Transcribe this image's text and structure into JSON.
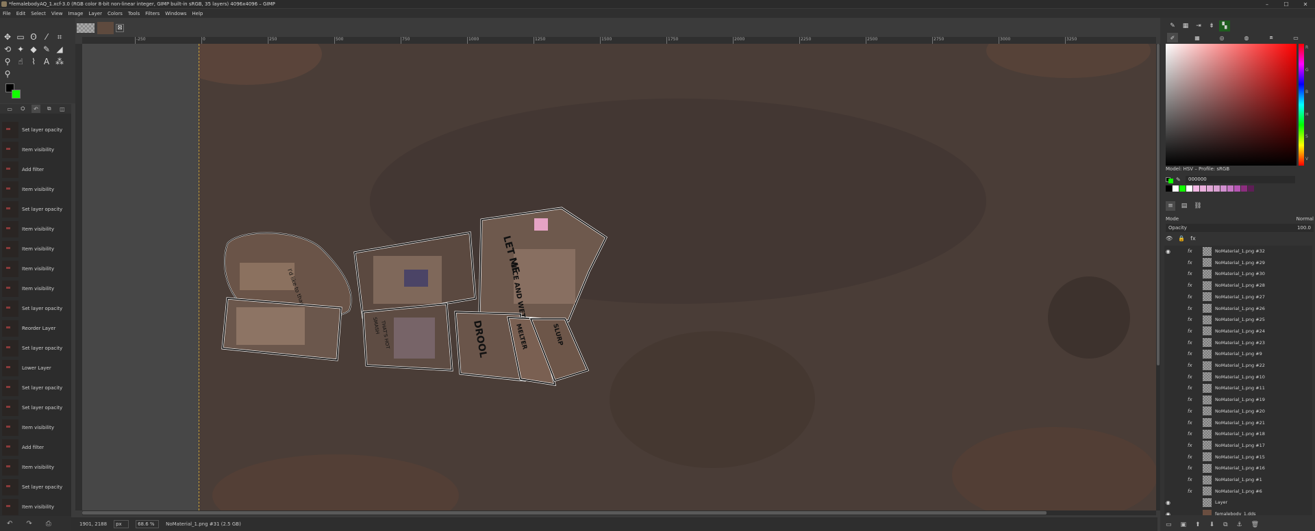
{
  "window": {
    "title": "*femalebodyAQ_1.xcf-3.0 (RGB color 8-bit non-linear integer, GIMP built-in sRGB, 35 layers) 4096x4096 – GIMP",
    "minimize": "–",
    "maximize": "☐",
    "close": "✕"
  },
  "menu": [
    "File",
    "Edit",
    "Select",
    "View",
    "Image",
    "Layer",
    "Colors",
    "Tools",
    "Filters",
    "Windows",
    "Help"
  ],
  "toolbox": {
    "tools": [
      {
        "name": "move-tool-icon",
        "glyph": "✥"
      },
      {
        "name": "rect-select-icon",
        "glyph": "▭"
      },
      {
        "name": "lasso-icon",
        "glyph": "ʘ"
      },
      {
        "name": "fuzzy-select-icon",
        "glyph": "⁄"
      },
      {
        "name": "crop-icon",
        "glyph": "⌗"
      },
      {
        "name": "transform-icon",
        "glyph": "⟲"
      },
      {
        "name": "warp-icon",
        "glyph": "✦"
      },
      {
        "name": "bucket-fill-icon",
        "glyph": "◆"
      },
      {
        "name": "paintbrush-icon",
        "glyph": "✎"
      },
      {
        "name": "eraser-icon",
        "glyph": "◢"
      },
      {
        "name": "clone-icon",
        "glyph": "⚲"
      },
      {
        "name": "smudge-icon",
        "glyph": "☝"
      },
      {
        "name": "paths-icon",
        "glyph": "⌇"
      },
      {
        "name": "text-icon",
        "glyph": "A"
      },
      {
        "name": "color-picker-icon",
        "glyph": "⁂"
      },
      {
        "name": "zoom-icon",
        "glyph": "⚲"
      }
    ],
    "fg_color": "#000000",
    "bg_color": "#11ff00"
  },
  "history": {
    "tabs": [
      "▭",
      "⛭",
      "↶",
      "⧉",
      "◫"
    ],
    "items": [
      "Set layer opacity",
      "Item visibility",
      "Add filter",
      "Item visibility",
      "Set layer opacity",
      "Item visibility",
      "Item visibility",
      "Item visibility",
      "Item visibility",
      "Set layer opacity",
      "Reorder Layer",
      "Set layer opacity",
      "Lower Layer",
      "Set layer opacity",
      "Set layer opacity",
      "Item visibility",
      "Add filter",
      "Item visibility",
      "Set layer opacity",
      "Item visibility"
    ],
    "bottom_icons": [
      "↶",
      "↷",
      "⎙"
    ]
  },
  "ruler": {
    "ticks": [
      "-250",
      "0",
      "250",
      "500",
      "750",
      "1000",
      "1250",
      "1500",
      "1750",
      "2000",
      "2250",
      "2500",
      "2750",
      "3000",
      "3250"
    ]
  },
  "status": {
    "coords": "1901, 2188",
    "unit": "px",
    "zoom": "68.6 %",
    "info": "NoMaterial_1.png #31 (2.5 GB)"
  },
  "dock": {
    "top_icons": [
      "✎",
      "▦",
      "⇥",
      "⇟",
      "▚"
    ],
    "color_tabs": [
      "✐",
      "▦",
      "◎",
      "◍",
      "⧈",
      "▭"
    ],
    "hue_letters": [
      "R",
      "G",
      "B",
      "H",
      "S",
      "V"
    ],
    "color_model": "Model: HSV – Profile: sRGB",
    "hex_value": "000000",
    "swatches": [
      "#000000",
      "#ffffff",
      "#11ff00",
      "#ffffff",
      "#f2b8e4",
      "#eab0dd",
      "#e0a8d6",
      "#d9a0d2",
      "#d18fcf",
      "#c676c4",
      "#b655b4",
      "#8c2d7e",
      "#5e1e56"
    ]
  },
  "layers": {
    "tabs": [
      "≡",
      "▤",
      "⛓"
    ],
    "mode_label": "Mode",
    "mode_value": "Normal",
    "opacity_label": "Opacity",
    "opacity_value": "100.0",
    "lock_icons": [
      "👁",
      "🔒",
      "fx"
    ],
    "rows": [
      {
        "name": "NoMaterial_1.png #32",
        "visible": true
      },
      {
        "name": "NoMaterial_1.png #29",
        "visible": false
      },
      {
        "name": "NoMaterial_1.png #30",
        "visible": false
      },
      {
        "name": "NoMaterial_1.png #28",
        "visible": false
      },
      {
        "name": "NoMaterial_1.png #27",
        "visible": false
      },
      {
        "name": "NoMaterial_1.png #26",
        "visible": false
      },
      {
        "name": "NoMaterial_1.png #25",
        "visible": false
      },
      {
        "name": "NoMaterial_1.png #24",
        "visible": false
      },
      {
        "name": "NoMaterial_1.png #23",
        "visible": false
      },
      {
        "name": "NoMaterial_1.png #9",
        "visible": false
      },
      {
        "name": "NoMaterial_1.png #22",
        "visible": false
      },
      {
        "name": "NoMaterial_1.png #10",
        "visible": false
      },
      {
        "name": "NoMaterial_1.png #11",
        "visible": false
      },
      {
        "name": "NoMaterial_1.png #19",
        "visible": false
      },
      {
        "name": "NoMaterial_1.png #20",
        "visible": false
      },
      {
        "name": "NoMaterial_1.png #21",
        "visible": false
      },
      {
        "name": "NoMaterial_1.png #18",
        "visible": false
      },
      {
        "name": "NoMaterial_1.png #17",
        "visible": false
      },
      {
        "name": "NoMaterial_1.png #15",
        "visible": false
      },
      {
        "name": "NoMaterial_1.png #16",
        "visible": false
      },
      {
        "name": "NoMaterial_1.png #1",
        "visible": false
      },
      {
        "name": "NoMaterial_1.png #6",
        "visible": false
      },
      {
        "name": "Layer",
        "visible": true
      },
      {
        "name": "femalebody_1.dds",
        "visible": true
      }
    ],
    "bottom_icons": [
      "▭",
      "▣",
      "⬆",
      "⬇",
      "⧉",
      "⚓",
      "🗑"
    ]
  },
  "canvas": {
    "patch_texts": [
      "I'd like to thank my body",
      "LET ME",
      "NICE AND WET",
      "DROOL",
      "SLURP",
      "SMASH",
      "THAT'S HOT",
      "MELTER"
    ]
  }
}
